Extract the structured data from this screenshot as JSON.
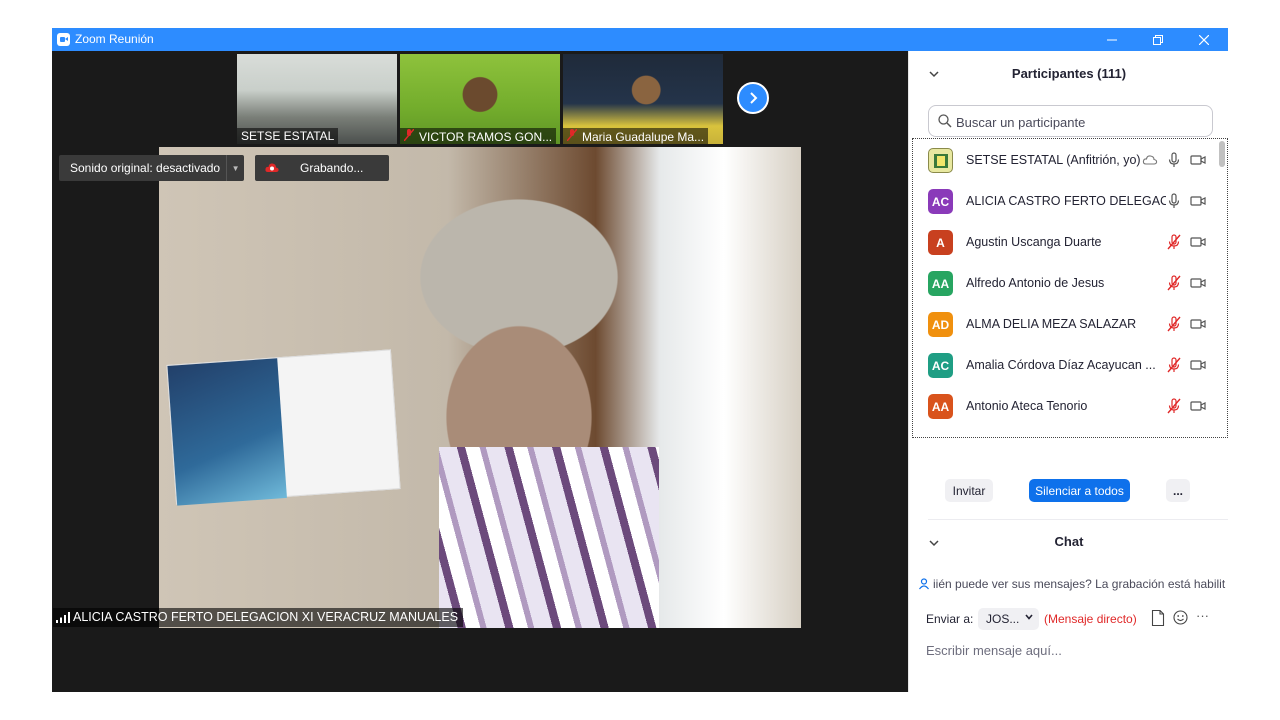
{
  "window": {
    "title": "Zoom Reunión"
  },
  "thumbnails": [
    {
      "name": "SETSE ESTATAL",
      "muted": false
    },
    {
      "name": "VICTOR RAMOS GON...",
      "muted": true
    },
    {
      "name": "Maria Guadalupe Ma...",
      "muted": true
    }
  ],
  "video": {
    "sound_label": "Sonido original: desactivado",
    "recording_label": "Grabando...",
    "speaker_name": "ALICIA CASTRO FERTO DELEGACION XI VERACRUZ MANUALES"
  },
  "participants": {
    "title": "Participantes (111)",
    "search_placeholder": "Buscar un participante",
    "items": [
      {
        "initials": "",
        "name": "SETSE ESTATAL (Anfitrión, yo)",
        "color": "#e8e8a0",
        "mic": "on"
      },
      {
        "initials": "AC",
        "name": "ALICIA CASTRO FERTO DELEGAC...",
        "color": "#8a3ab9",
        "mic": "on"
      },
      {
        "initials": "A",
        "name": "Agustin Uscanga Duarte",
        "color": "#c8401f",
        "mic": "off"
      },
      {
        "initials": "AA",
        "name": "Alfredo Antonio de Jesus",
        "color": "#27a561",
        "mic": "off"
      },
      {
        "initials": "AD",
        "name": "ALMA DELIA MEZA SALAZAR",
        "color": "#f0900e",
        "mic": "off"
      },
      {
        "initials": "AC",
        "name": "Amalia Córdova Díaz Acayucan ...",
        "color": "#1f9e84",
        "mic": "off"
      },
      {
        "initials": "AA",
        "name": "Antonio Ateca Tenorio",
        "color": "#d9531c",
        "mic": "off"
      }
    ],
    "invite_label": "Invitar",
    "mute_all_label": "Silenciar a todos",
    "more_label": "..."
  },
  "chat": {
    "title": "Chat",
    "privacy_notice": "iién puede ver sus mensajes? La grabación está habilit",
    "send_to_label": "Enviar a:",
    "recipient": "JOS...",
    "direct_message": "(Mensaje directo)",
    "more_label": "···",
    "input_placeholder": "Escribir mensaje aquí..."
  },
  "colors": {
    "accent": "#2d8cff",
    "button_blue": "#0e71eb",
    "muted_red": "#e02828"
  }
}
